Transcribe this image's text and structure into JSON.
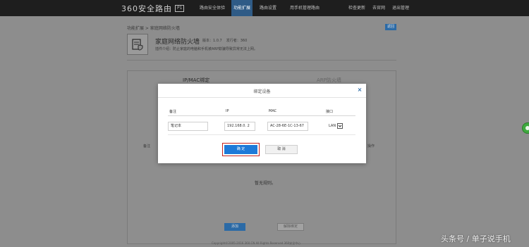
{
  "header": {
    "brand": "360安全路由",
    "brand_badge": "P1",
    "nav": [
      "路由安全体验",
      "功能扩展",
      "路由设置",
      "用手机管理路由"
    ],
    "active_nav": "功能扩展",
    "links": [
      "检查更新",
      "去官网",
      "退出管理"
    ]
  },
  "page": {
    "breadcrumb": "功能扩展 > 家庭网络防火墙",
    "back_label": "返回",
    "feature_title": "家庭网络防火墙",
    "version": "版本：1.0.7",
    "author": "发行者：360",
    "description": "插件介绍：防止家庭的电脑和手机被ARP欺骗导致异常无法上网。",
    "tabs": [
      "IP/MAC绑定",
      "ARP防火墙"
    ],
    "col_note": "备注",
    "col_action": "操作",
    "empty_text": "暂无规则。",
    "add_button": "添加",
    "unbind_button": "解除绑定",
    "copyright": "Copyright©2005-2016 360.CN All Rights Reserved 360安全中心"
  },
  "modal": {
    "title": "绑定设备",
    "close": "×",
    "columns": [
      "备注",
      "IP",
      "MAC",
      "接口"
    ],
    "row": {
      "note": "笔记本",
      "ip": "192.168.0. 2",
      "mac": "AC-28-6E-1C-13-67",
      "interface": "LAN"
    },
    "confirm": "确 定",
    "cancel": "取 消"
  },
  "watermark": "头条号 / 单子说手机"
}
